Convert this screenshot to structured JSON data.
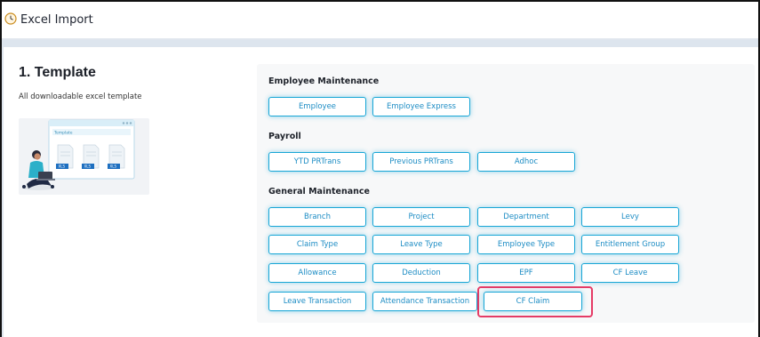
{
  "header": {
    "title": "Excel Import",
    "icon": "clock-icon"
  },
  "template": {
    "title": "1. Template",
    "description": "All downloadable excel template",
    "illustration": {
      "window_label": "Template",
      "file_labels": [
        "XLS",
        "XLS",
        "XLS"
      ]
    }
  },
  "groups": {
    "employee_maintenance": {
      "title": "Employee Maintenance",
      "buttons": [
        "Employee",
        "Employee Express"
      ]
    },
    "payroll": {
      "title": "Payroll",
      "buttons": [
        "YTD PRTrans",
        "Previous PRTrans",
        "Adhoc"
      ]
    },
    "general_maintenance": {
      "title": "General Maintenance",
      "buttons": [
        "Branch",
        "Project",
        "Department",
        "Levy",
        "Claim Type",
        "Leave Type",
        "Employee Type",
        "Entitlement Group",
        "Allowance",
        "Deduction",
        "EPF",
        "CF Leave",
        "Leave Transaction",
        "Attendance Transaction",
        "CF Claim"
      ]
    }
  },
  "highlighted_button": "CF Claim",
  "colors": {
    "accent": "#18a6d6",
    "button_text": "#1c8cc4",
    "highlight": "#e53b66"
  }
}
